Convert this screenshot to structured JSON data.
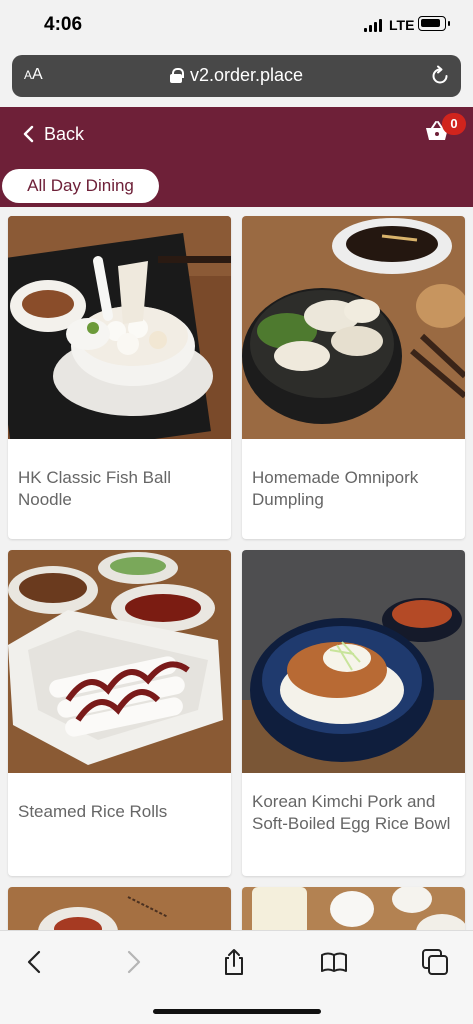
{
  "status_bar": {
    "time": "4:06",
    "network": "LTE"
  },
  "browser": {
    "text_size_label_small": "A",
    "text_size_label_large": "A",
    "url": "v2.order.place"
  },
  "header": {
    "back_label": "Back",
    "cart_count": "0",
    "category_tab": "All Day Dining",
    "colors": {
      "primary": "#6e2038",
      "badge": "#d1241d"
    }
  },
  "menu_items": [
    {
      "name": "HK Classic Fish Ball Noodle"
    },
    {
      "name": "Homemade Omnipork Dumpling"
    },
    {
      "name": "Steamed Rice Rolls"
    },
    {
      "name": "Korean Kimchi Pork and Soft-Boiled Egg Rice Bowl"
    }
  ],
  "toolbar": {
    "icons": [
      "back-arrow-icon",
      "forward-arrow-icon",
      "share-icon",
      "bookmarks-icon",
      "tabs-icon"
    ]
  }
}
